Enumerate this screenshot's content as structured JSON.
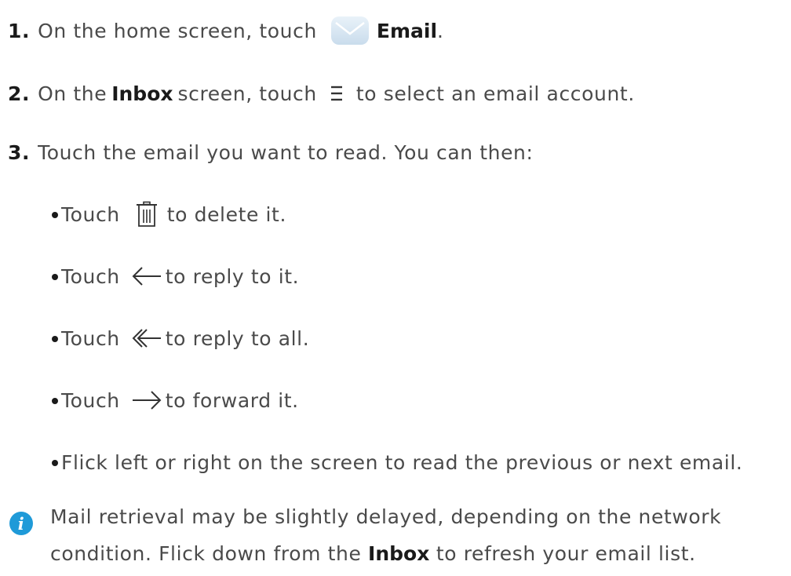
{
  "steps": [
    {
      "number": "1.",
      "before": "On the home screen, touch",
      "bold": "Email",
      "after": "."
    },
    {
      "number": "2.",
      "before": "On the",
      "bold": "Inbox",
      "middle": "screen, touch",
      "after": "to select an email account."
    },
    {
      "number": "3.",
      "text": "Touch the email you want to read. You can then:"
    }
  ],
  "bullets": [
    {
      "lead": "Touch",
      "rest": "to delete it.",
      "icon": "trash-icon"
    },
    {
      "lead": "Touch",
      "rest": "to reply to it.",
      "icon": "reply-arrow-icon"
    },
    {
      "lead": "Touch",
      "rest": "to reply to all.",
      "icon": "reply-all-arrow-icon"
    },
    {
      "lead": "Touch",
      "rest": "to forward it.",
      "icon": "forward-arrow-icon"
    },
    {
      "text": "Flick left or right on the screen to read the previous or next email."
    }
  ],
  "note": {
    "icon": "info-icon",
    "icon_glyph": "i",
    "line1": "Mail retrieval may be slightly delayed, depending on the network",
    "line2_before": "condition. Flick down from the",
    "line2_bold": "Inbox",
    "line2_after": "to refresh your email list."
  },
  "colors": {
    "text": "#4a4a4a",
    "bold_text": "#1a1a1a",
    "info_blue": "#1f9ad8",
    "email_icon": "#d6e6f2"
  }
}
